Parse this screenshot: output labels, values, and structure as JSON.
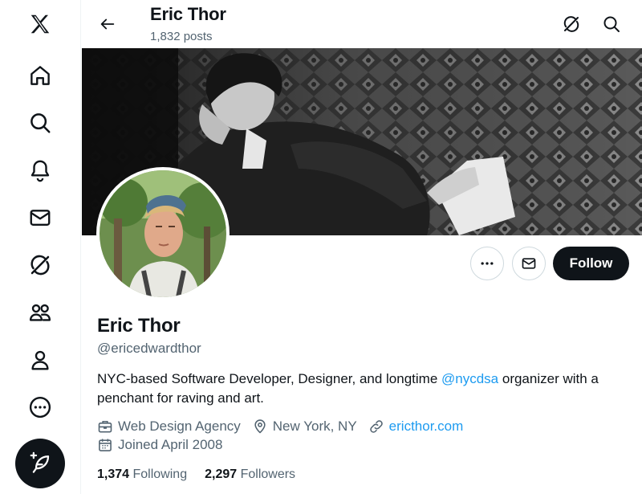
{
  "sidebar": {
    "items": [
      {
        "name": "x-logo",
        "icon": "x-logo-icon"
      },
      {
        "name": "home",
        "icon": "home-icon"
      },
      {
        "name": "explore",
        "icon": "search-icon"
      },
      {
        "name": "notifications",
        "icon": "bell-icon"
      },
      {
        "name": "messages",
        "icon": "mail-icon"
      },
      {
        "name": "grok",
        "icon": "grok-icon"
      },
      {
        "name": "communities",
        "icon": "people-icon"
      },
      {
        "name": "profile",
        "icon": "person-icon"
      },
      {
        "name": "more",
        "icon": "more-circle-icon"
      }
    ],
    "compose_icon": "feather-plus-icon"
  },
  "header": {
    "name": "Eric Thor",
    "posts": "1,832 posts",
    "icons": [
      "back-arrow-icon",
      "grok-icon",
      "search-icon"
    ]
  },
  "profile": {
    "name": "Eric Thor",
    "handle": "@ericedwardthor",
    "bio_pre": "NYC-based Software Developer, Designer, and longtime ",
    "bio_mention": "@nycdsa",
    "bio_post": " organizer with a penchant for raving and art.",
    "category": "Web Design Agency",
    "location": "New York, NY",
    "website": "ericthor.com",
    "joined": "Joined April 2008",
    "following_count": "1,374",
    "following_label": "Following",
    "followers_count": "2,297",
    "followers_label": "Followers"
  },
  "actions": {
    "follow_label": "Follow",
    "more_icon": "more-dots-icon",
    "message_icon": "mail-icon"
  },
  "colors": {
    "accent": "#1d9bf0",
    "text": "#0f1419",
    "secondary": "#536471",
    "button_dark": "#0f1419"
  }
}
